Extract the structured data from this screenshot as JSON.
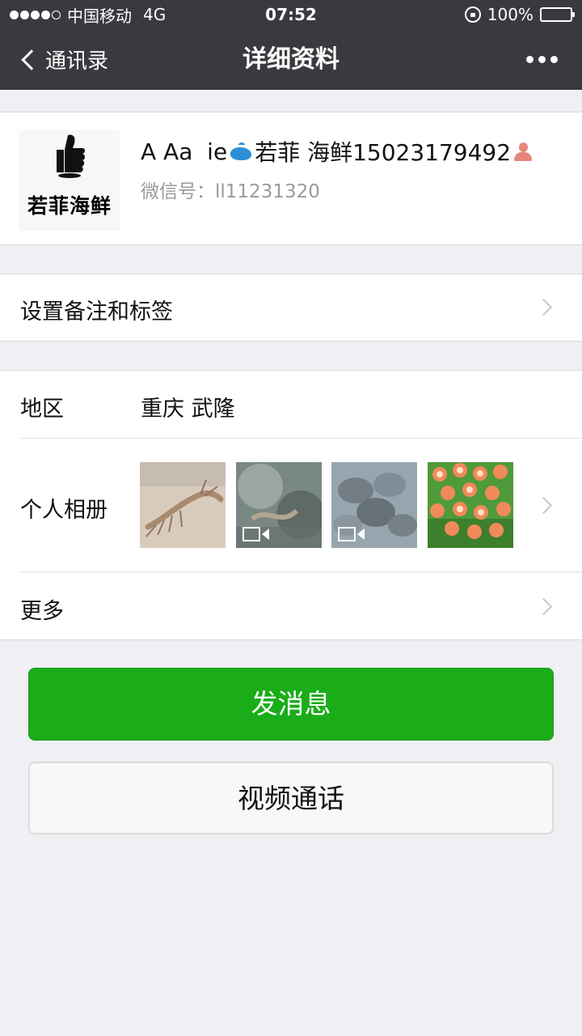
{
  "status_bar": {
    "carrier": "中国移动",
    "network": "4G",
    "time": "07:52",
    "battery": "100%",
    "signal_bars_filled": 4,
    "signal_bars_total": 5
  },
  "nav": {
    "back_label": "通讯录",
    "title": "详细资料",
    "more_icon": "more-dots-icon"
  },
  "profile": {
    "avatar_text": "若菲海鲜",
    "nickname_part1": "A Aa  ie",
    "nickname_part2": "若菲 海鲜15023179492",
    "wechat_id": "微信号：ll11231320"
  },
  "remark_row": {
    "label": "设置备注和标签"
  },
  "region_row": {
    "label": "地区",
    "value": "重庆 武隆"
  },
  "album_row": {
    "label": "个人相册",
    "photos": [
      {
        "subject": "mantis-shrimp",
        "is_video": false
      },
      {
        "subject": "seafood-in-water",
        "is_video": true
      },
      {
        "subject": "clams",
        "is_video": true
      },
      {
        "subject": "shrimp-dish",
        "is_video": false
      }
    ]
  },
  "more_row": {
    "label": "更多"
  },
  "buttons": {
    "send_message": "发消息",
    "video_call": "视频通话"
  },
  "colors": {
    "nav_bg": "#393a3f",
    "page_bg": "#efeff4",
    "primary_green": "#1aad19",
    "secondary_text": "#9b9b9b"
  }
}
